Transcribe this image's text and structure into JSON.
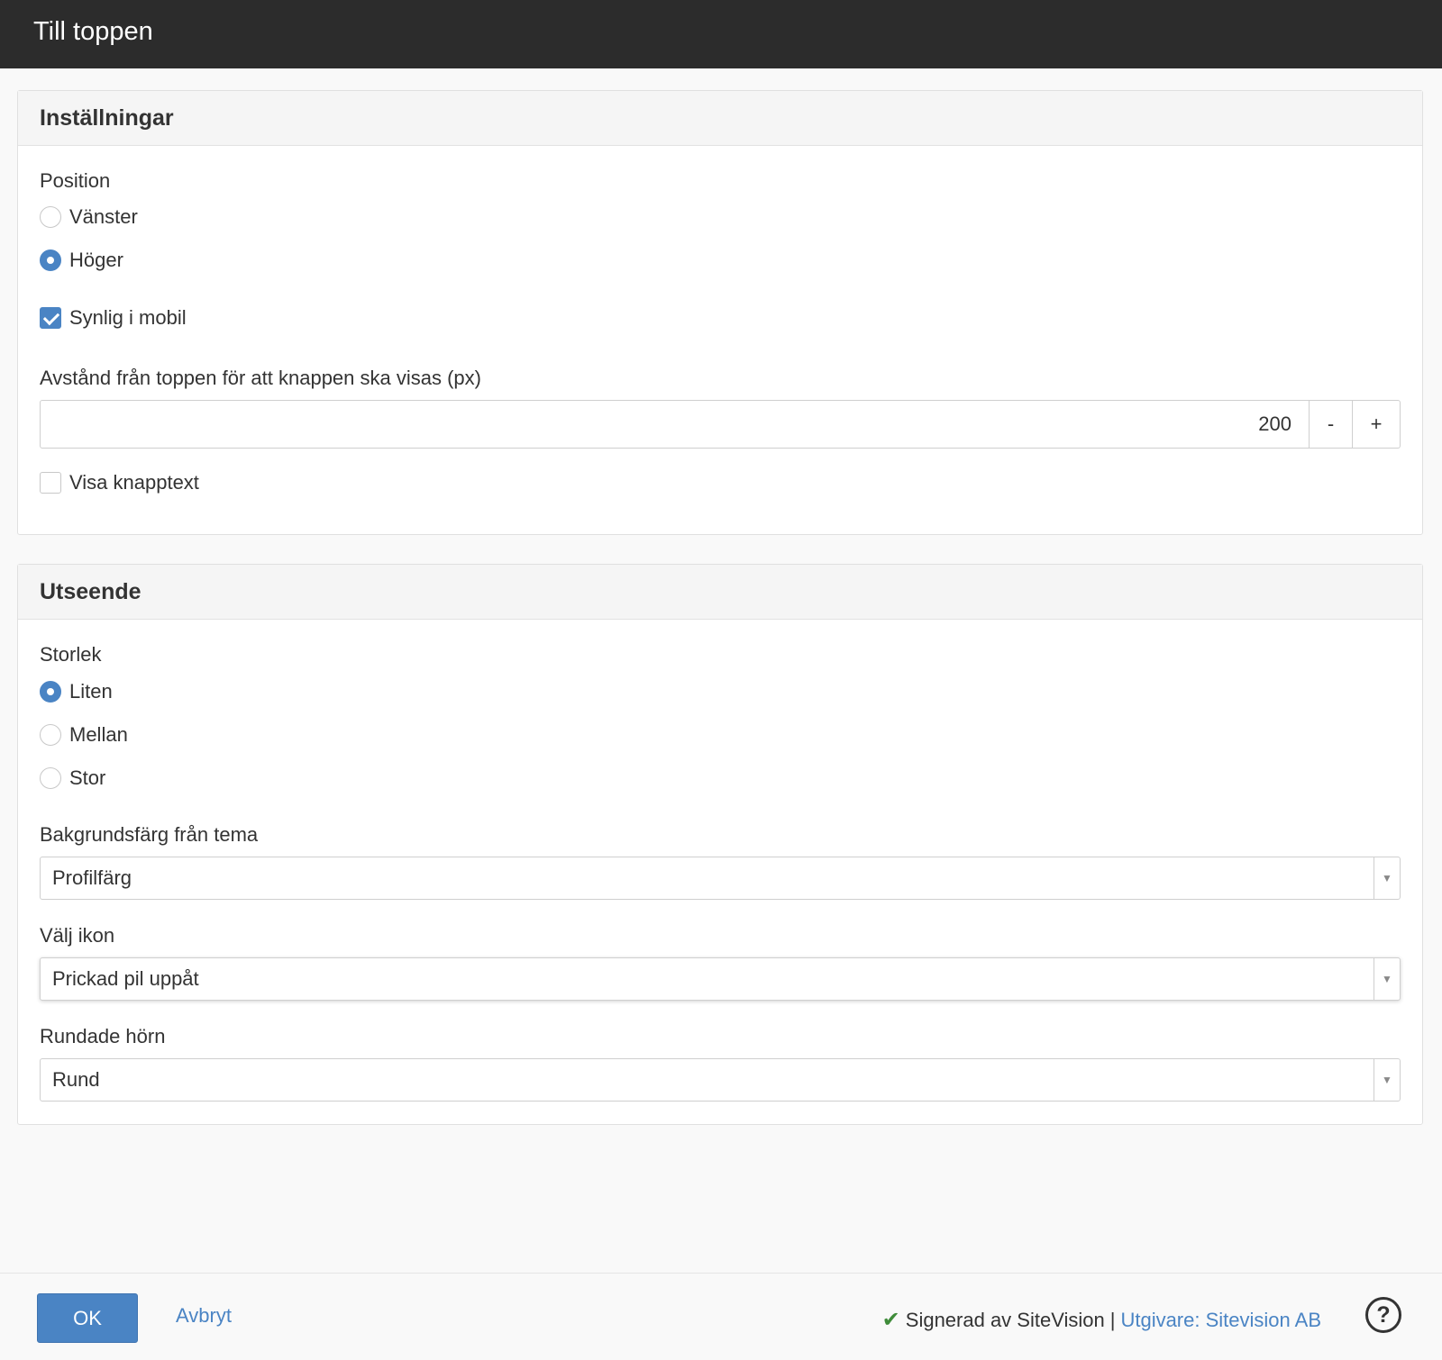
{
  "window": {
    "title": "Till toppen"
  },
  "settings": {
    "heading": "Inställningar",
    "position": {
      "label": "Position",
      "options": [
        {
          "label": "Vänster",
          "selected": false
        },
        {
          "label": "Höger",
          "selected": true
        }
      ]
    },
    "mobile_visible": {
      "label": "Synlig i mobil",
      "checked": true
    },
    "distance": {
      "label": "Avstånd från toppen för att knappen ska visas (px)",
      "value": "200",
      "decrement_label": "-",
      "increment_label": "+"
    },
    "show_text": {
      "label": "Visa knapptext",
      "checked": false
    }
  },
  "appearance": {
    "heading": "Utseende",
    "size": {
      "label": "Storlek",
      "options": [
        {
          "label": "Liten",
          "selected": true
        },
        {
          "label": "Mellan",
          "selected": false
        },
        {
          "label": "Stor",
          "selected": false
        }
      ]
    },
    "background": {
      "label": "Bakgrundsfärg från tema",
      "value": "Profilfärg"
    },
    "icon": {
      "label": "Välj ikon",
      "value": "Prickad pil uppåt"
    },
    "corners": {
      "label": "Rundade hörn",
      "value": "Rund"
    }
  },
  "footer": {
    "ok_label": "OK",
    "cancel_label": "Avbryt",
    "signed_text": "Signerad av SiteVision",
    "separator": "|",
    "publisher_link": "Utgivare: Sitevision AB",
    "help_glyph": "?"
  },
  "colors": {
    "accent": "#4a84c4",
    "titlebar": "#2c2c2c",
    "check_green": "#3f8c3a"
  },
  "icons": [
    "checkmark-icon",
    "help-icon",
    "chevron-down-icon"
  ]
}
